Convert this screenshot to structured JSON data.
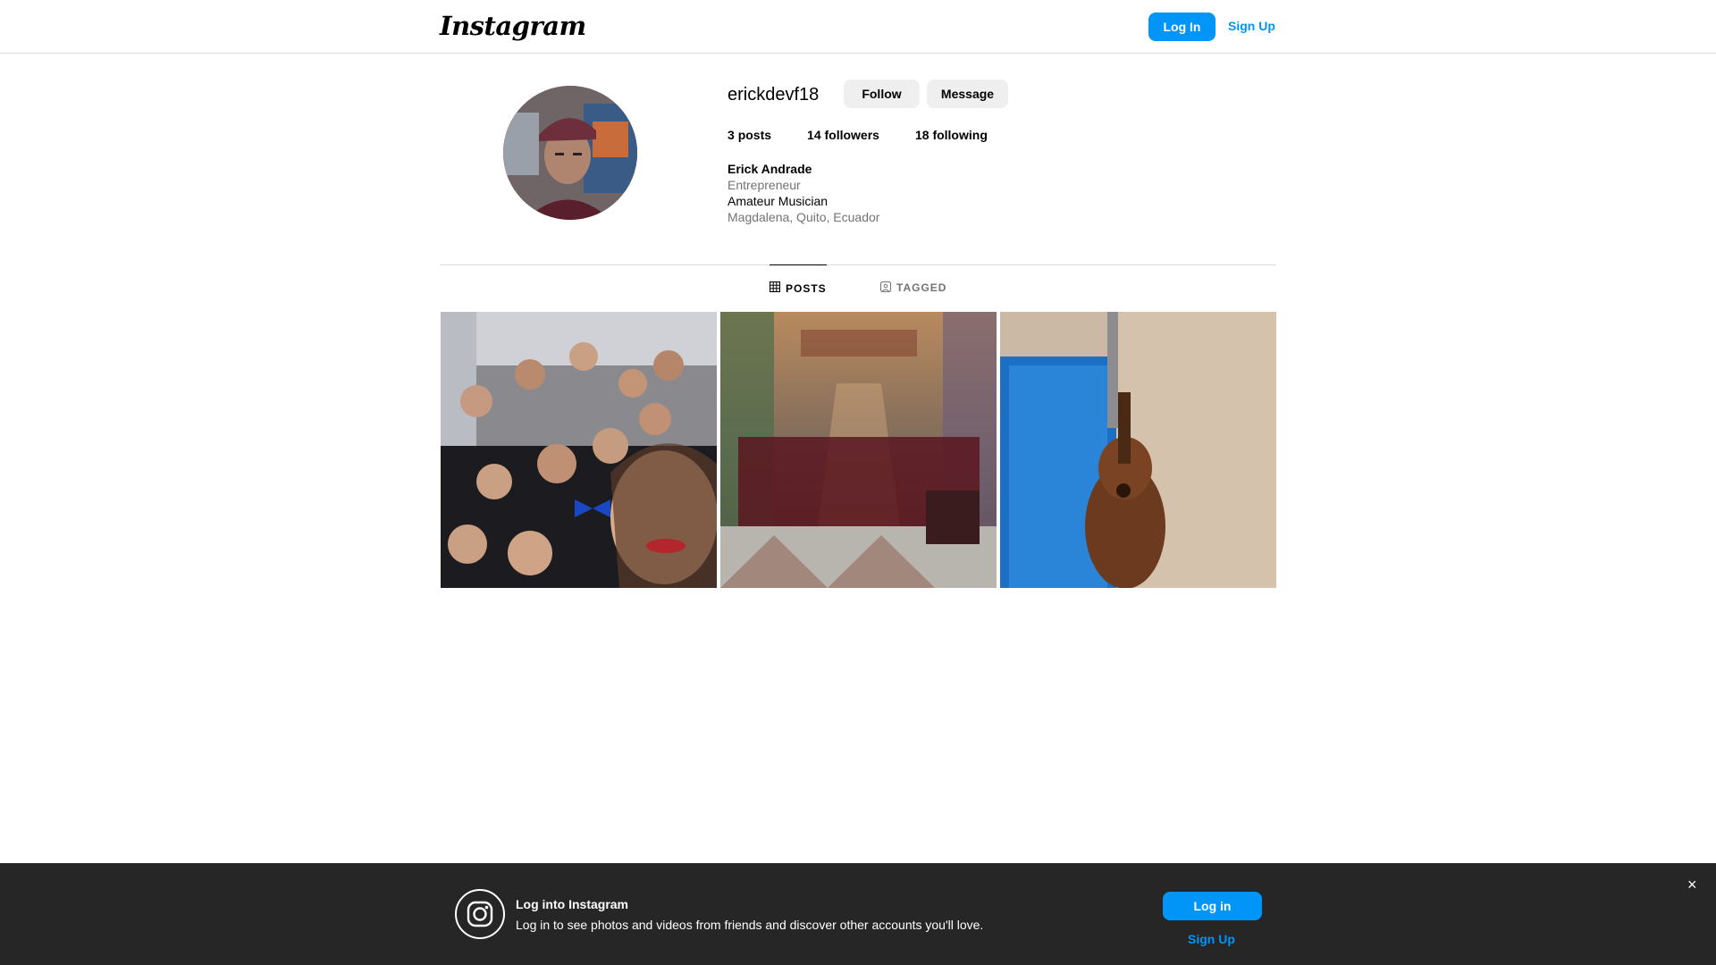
{
  "nav": {
    "logo": "Instagram",
    "login_label": "Log In",
    "signup_label": "Sign Up"
  },
  "profile": {
    "username": "erickdevf18",
    "follow_label": "Follow",
    "message_label": "Message",
    "stats": {
      "posts_count": "3",
      "posts_label": "posts",
      "followers_count": "14",
      "followers_label": "followers",
      "following_count": "18",
      "following_label": "following"
    },
    "bio": {
      "full_name": "Erick Andrade",
      "category": "Entrepreneur",
      "line": "Amateur Musician",
      "location": "Magdalena, Quito, Ecuador"
    }
  },
  "tabs": [
    {
      "label": "POSTS",
      "icon": "grid-icon",
      "active": true
    },
    {
      "label": "TAGGED",
      "icon": "tagged-icon",
      "active": false
    }
  ],
  "posts": [
    {
      "icon": "group-selfie-photo"
    },
    {
      "icon": "choir-cathedral-photo"
    },
    {
      "icon": "guitar-photo"
    }
  ],
  "banner": {
    "title": "Log into Instagram",
    "text": "Log in to see photos and videos from friends and discover other accounts you'll love.",
    "login_label": "Log in",
    "signup_label": "Sign Up",
    "close_glyph": "×"
  },
  "colors": {
    "accent": "#0095f6",
    "banner_bg": "#262626",
    "secondary_text": "#737373",
    "button_bg": "#efefef"
  }
}
